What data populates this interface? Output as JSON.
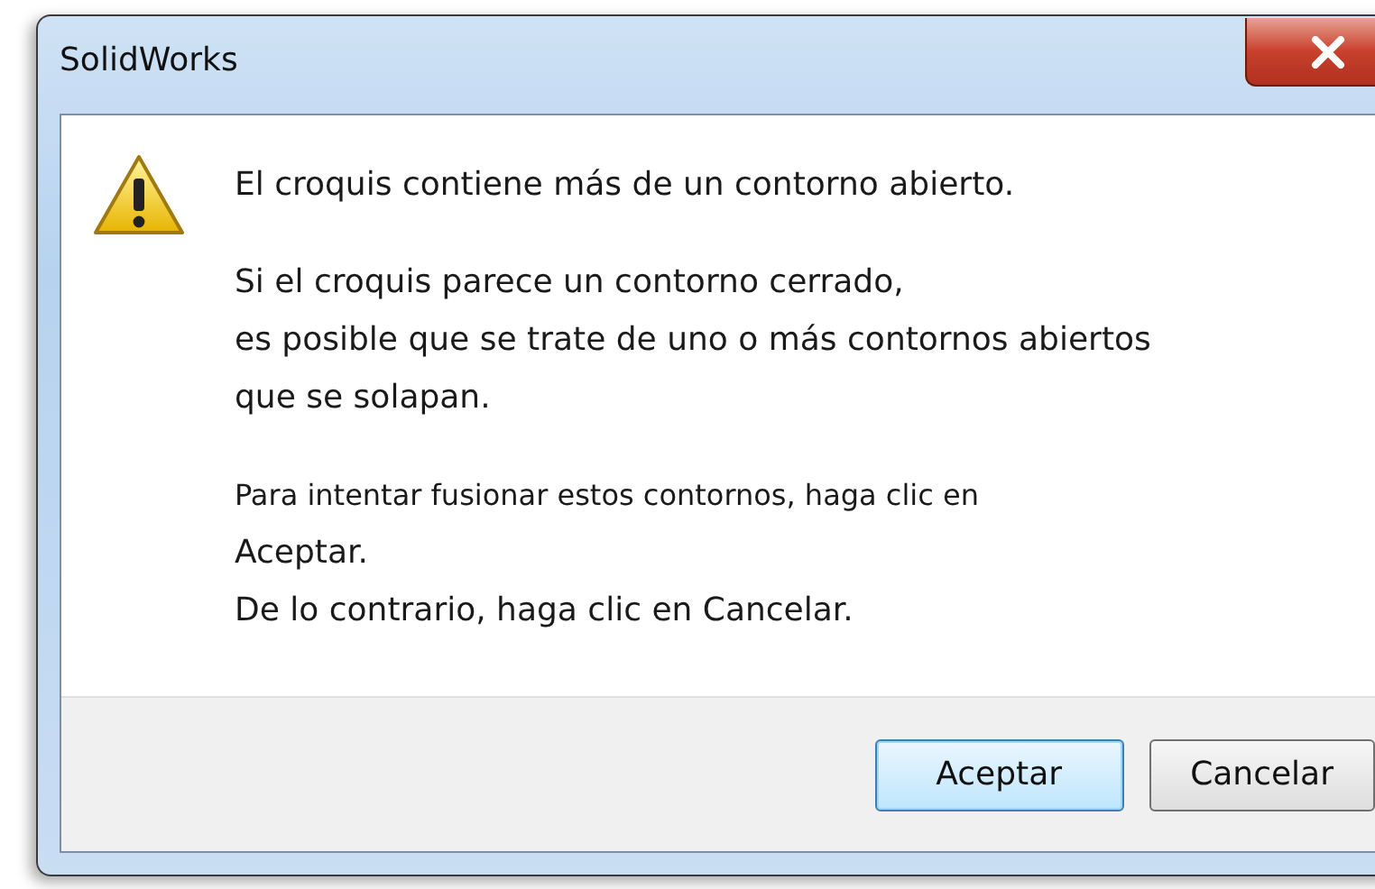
{
  "window": {
    "title": "SolidWorks"
  },
  "message": {
    "paragraphs": [
      {
        "kind": "normal",
        "lines": [
          "El croquis contiene más de un contorno abierto."
        ]
      },
      {
        "kind": "normal",
        "lines": [
          "Si el croquis parece un contorno cerrado,",
          "es posible que se trate de uno o más contornos abiertos",
          "que se solapan."
        ]
      },
      {
        "kind": "small-first",
        "lines": [
          "Para intentar fusionar estos contornos, haga clic en",
          "Aceptar.",
          "De lo contrario, haga clic en Cancelar."
        ]
      }
    ]
  },
  "buttons": [
    {
      "label": "Aceptar",
      "default": true
    },
    {
      "label": "Cancelar",
      "default": false
    }
  ]
}
